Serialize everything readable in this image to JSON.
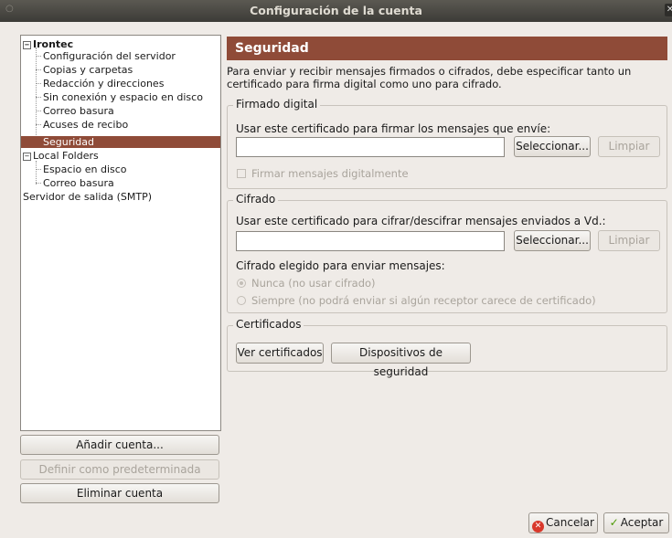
{
  "window": {
    "title": "Configuración de la cuenta"
  },
  "tree": {
    "account1": "Irontec",
    "account1_items": [
      "Configuración del servidor",
      "Copias y carpetas",
      "Redacción y direcciones",
      "Sin conexión y espacio en disco",
      "Correo basura",
      "Acuses de recibo",
      "Seguridad"
    ],
    "account2": "Local Folders",
    "account2_items": [
      "Espacio en disco",
      "Correo basura"
    ],
    "smtp": "Servidor de salida (SMTP)",
    "selected": "Seguridad"
  },
  "left_buttons": {
    "add": "Añadir cuenta...",
    "default": "Definir como predeterminada",
    "remove": "Eliminar cuenta"
  },
  "page": {
    "title": "Seguridad",
    "description": "Para enviar y recibir mensajes firmados o cifrados, debe especificar tanto un certificado para firma digital como uno para cifrado."
  },
  "signing": {
    "legend": "Firmado digital",
    "cert_label": "Usar este certificado para firmar los mensajes que envíe:",
    "cert_value": "",
    "select": "Seleccionar...",
    "clear": "Limpiar",
    "sign_checkbox": "Firmar mensajes digitalmente"
  },
  "encryption": {
    "legend": "Cifrado",
    "cert_label": "Usar este certificado para cifrar/descifrar mensajes enviados a Vd.:",
    "cert_value": "",
    "select": "Seleccionar...",
    "clear": "Limpiar",
    "choice_label": "Cifrado elegido para enviar mensajes:",
    "option_never": "Nunca (no usar cifrado)",
    "option_always": "Siempre (no podrá enviar si algún receptor carece de certificado)"
  },
  "certificates": {
    "legend": "Certificados",
    "view": "Ver certificados",
    "devices": "Dispositivos de seguridad"
  },
  "dialog": {
    "cancel": "Cancelar",
    "accept": "Aceptar"
  },
  "colors": {
    "accent": "#8f4b38",
    "titlebar": "#3c3b37",
    "background": "#efebe7"
  }
}
